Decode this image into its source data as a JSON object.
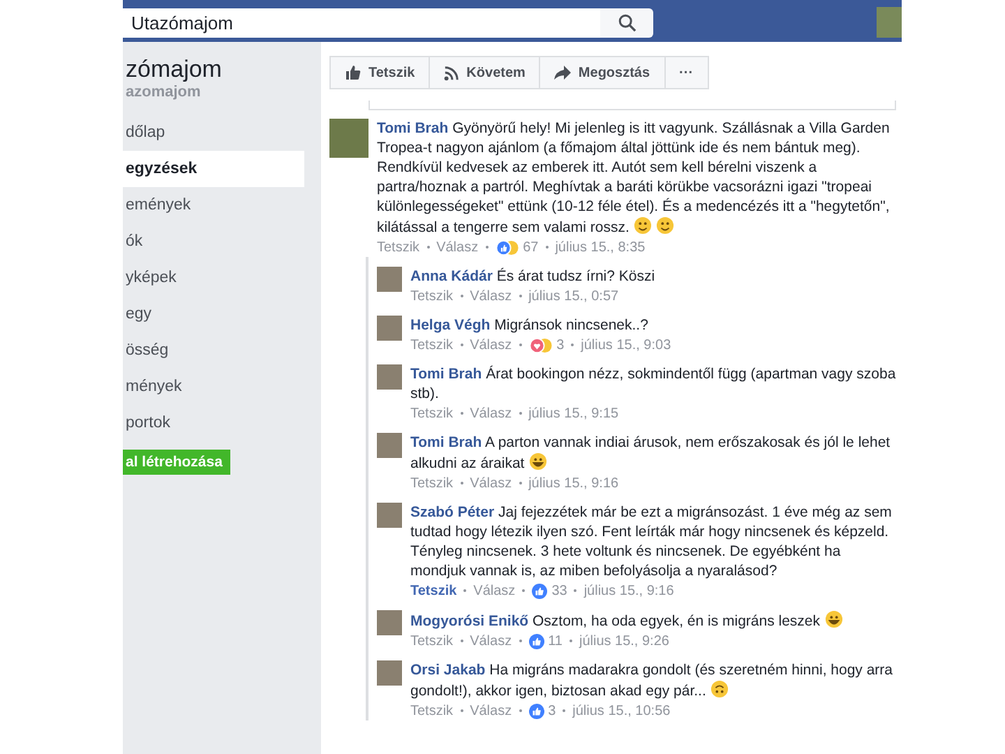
{
  "topbar": {
    "search_value": "Utazómajom"
  },
  "sidebar": {
    "page_name": "zómajom",
    "handle": "azomajom",
    "items": [
      {
        "label": "dőlap",
        "selected": false
      },
      {
        "label": "egyzések",
        "selected": true
      },
      {
        "label": "emények",
        "selected": false
      },
      {
        "label": "ók",
        "selected": false
      },
      {
        "label": "yképek",
        "selected": false
      },
      {
        "label": "egy",
        "selected": false
      },
      {
        "label": "össég",
        "selected": false
      },
      {
        "label": "mények",
        "selected": false
      },
      {
        "label": "portok",
        "selected": false
      }
    ],
    "create_button": "al létrehozása"
  },
  "actions": [
    {
      "kind": "like",
      "label": "Tetszik"
    },
    {
      "kind": "follow",
      "label": "Követem"
    },
    {
      "kind": "share",
      "label": "Megosztás"
    },
    {
      "kind": "more",
      "label": "···"
    }
  ],
  "comment": {
    "author": "Tomi Brah",
    "text": "Gyönyörű hely! Mi jelenleg is itt vagyunk. Szállásnak a Villa Garden Tropea-t nagyon ajánlom (a főmajom által jöttünk ide és nem bántuk meg). Rendkívül kedvesek az emberek itt. Autót sem kell bérelni viszenk a partra/hoznak a partról. Meghívtak a baráti körükbe vacsorázni igazi \"tropeai különlegességeket\" ettünk (10-12 féle étel). És a medencézés itt a \"hegytetőn\", kilátással a tengerre sem valami rossz.",
    "emoji": [
      {
        "kind": "smile"
      },
      {
        "kind": "smile"
      }
    ],
    "like": "Tetszik",
    "liked": false,
    "reply": "Válasz",
    "reaction": {
      "kind": "like-haha"
    },
    "count": "67",
    "time": "július 15., 8:35",
    "replies": [
      {
        "author": "Anna Kádár",
        "text": "És árat tudsz írni? Köszi",
        "like": "Tetszik",
        "liked": false,
        "reply": "Válasz",
        "time": "július 15., 0:57"
      },
      {
        "author": "Helga Végh",
        "text": "Migránsok nincsenek..?",
        "like": "Tetszik",
        "liked": false,
        "reply": "Válasz",
        "reaction": {
          "kind": "love-haha"
        },
        "count": "3",
        "time": "július 15., 9:03"
      },
      {
        "author": "Tomi Brah",
        "text": "Árat bookingon nézz, sokmindentől függ (apartman vagy szoba stb).",
        "like": "Tetszik",
        "liked": false,
        "reply": "Válasz",
        "time": "július 15., 9:15"
      },
      {
        "author": "Tomi Brah",
        "text": "A parton vannak indiai árusok, nem erőszakosak és jól le lehet alkudni az áraikat",
        "emoji": [
          {
            "kind": "laugh"
          }
        ],
        "like": "Tetszik",
        "liked": false,
        "reply": "Válasz",
        "time": "július 15., 9:16"
      },
      {
        "author": "Szabó Péter",
        "text": "Jaj fejezzétek már be ezt a migránsozást. 1 éve még az sem tudtad hogy létezik ilyen szó. Fent leírták már hogy nincsenek és képzeld. Tényleg nincsenek. 3 hete voltunk és nincsenek. De egyébként ha mondjuk vannak is, az miben befolyásolja a nyaralásod?",
        "like": "Tetszik",
        "liked": true,
        "reply": "Válasz",
        "reaction": {
          "kind": "like"
        },
        "count": "33",
        "time": "július 15., 9:16"
      },
      {
        "author": "Mogyorósi Enikő",
        "text": "Osztom, ha oda egyek, én is migráns leszek",
        "emoji": [
          {
            "kind": "laugh"
          }
        ],
        "like": "Tetszik",
        "liked": false,
        "reply": "Válasz",
        "reaction": {
          "kind": "like"
        },
        "count": "11",
        "time": "július 15., 9:26"
      },
      {
        "author": "Orsi Jakab",
        "text": "Ha migráns madarakra gondolt (és szeretném hinni, hogy arra gondolt!), akkor igen, biztosan akad egy pár...",
        "emoji": [
          {
            "kind": "upside"
          }
        ],
        "like": "Tetszik",
        "liked": false,
        "reply": "Válasz",
        "reaction": {
          "kind": "like"
        },
        "count": "3",
        "time": "július 15., 10:56"
      }
    ]
  }
}
